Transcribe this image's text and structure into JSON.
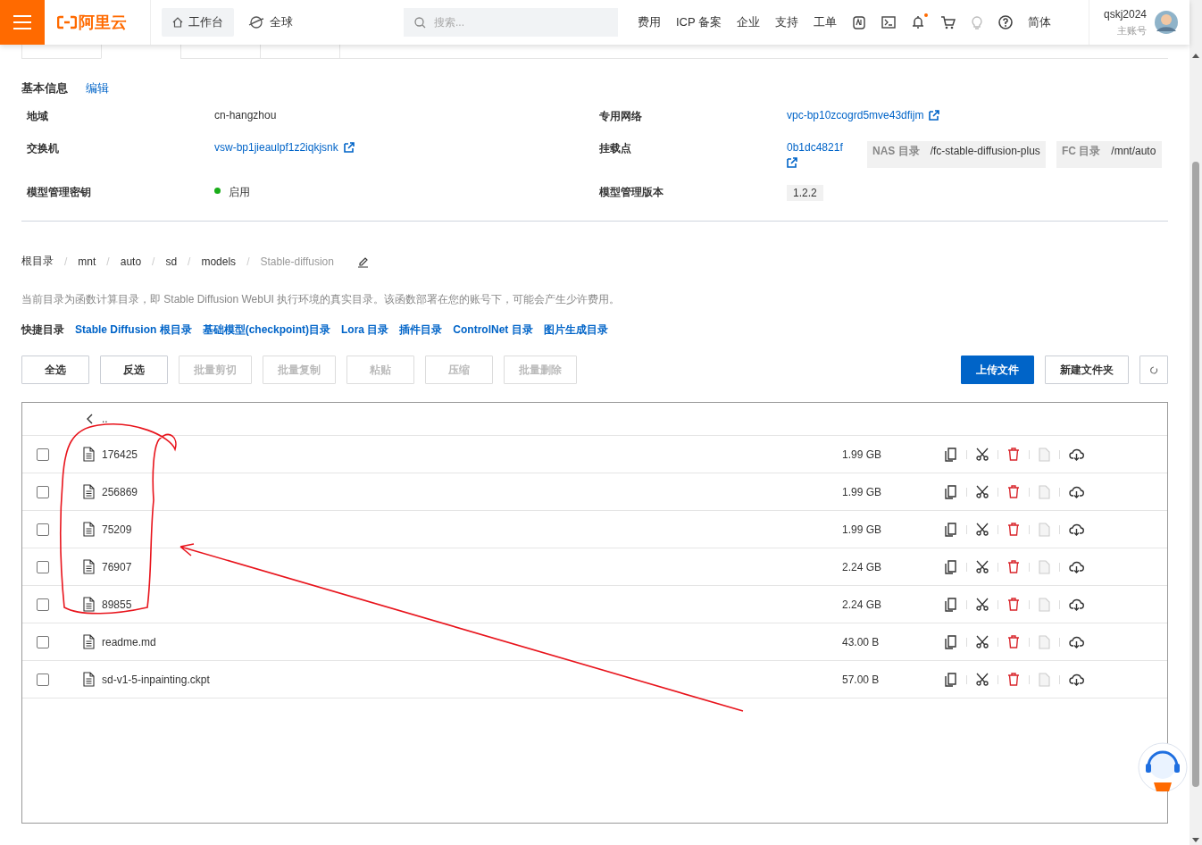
{
  "header": {
    "logo": "阿里云",
    "nav": [
      {
        "label": "工作台",
        "selected": true
      },
      {
        "label": "全球",
        "selected": false
      }
    ],
    "search": {
      "placeholder": "搜索..."
    },
    "links": [
      "费用",
      "ICP 备案",
      "企业",
      "支持",
      "工单"
    ],
    "notifications": {
      "unread": true
    },
    "language": "简体",
    "user": {
      "name": "qskj2024",
      "role": "主账号"
    }
  },
  "basic_info": {
    "title": "基本信息",
    "edit": "编辑",
    "fields": [
      {
        "kind": "text",
        "label": "地域",
        "value": "cn-hangzhou"
      },
      {
        "kind": "link",
        "label": "专用网络",
        "value": "vpc-bp10zcogrd5mve43dfijm"
      },
      {
        "kind": "link",
        "label": "交换机",
        "value": "vsw-bp1jieaulpf1z2iqkjsnk"
      },
      {
        "kind": "mount",
        "label": "挂载点",
        "value": "0b1dc4821f",
        "tags": [
          {
            "label": "NAS 目录",
            "value": "/fc-stable-diffusion-plus"
          },
          {
            "label": "FC 目录",
            "value": "/mnt/auto"
          }
        ]
      },
      {
        "kind": "status",
        "label": "模型管理密钥",
        "value": "启用",
        "on": true
      },
      {
        "kind": "tag",
        "label": "模型管理版本",
        "value": "1.2.2"
      }
    ]
  },
  "breadcrumb_separator": "/",
  "breadcrumb": [
    {
      "label": "根目录",
      "current": false
    },
    {
      "label": "mnt",
      "current": false
    },
    {
      "label": "auto",
      "current": false
    },
    {
      "label": "sd",
      "current": false
    },
    {
      "label": "models",
      "current": false
    },
    {
      "label": "Stable-diffusion",
      "current": true
    }
  ],
  "note": "当前目录为函数计算目录，即 Stable Diffusion WebUI 执行环境的真实目录。该函数部署在您的账号下，可能会产生少许费用。",
  "quick_dirs": {
    "label": "快捷目录",
    "links": [
      "Stable Diffusion 根目录",
      "基础模型(checkpoint)目录",
      "Lora 目录",
      "插件目录",
      "ControlNet 目录",
      "图片生成目录"
    ]
  },
  "toolbar": [
    {
      "label": "全选",
      "disabled": false
    },
    {
      "label": "反选",
      "disabled": false
    },
    {
      "label": "批量剪切",
      "disabled": true
    },
    {
      "label": "批量复制",
      "disabled": true
    },
    {
      "label": "粘贴",
      "disabled": true
    },
    {
      "label": "压缩",
      "disabled": true
    },
    {
      "label": "批量删除",
      "disabled": true
    }
  ],
  "actions": [
    {
      "label": "上传文件",
      "kind": "primary"
    },
    {
      "label": "新建文件夹",
      "kind": "default"
    }
  ],
  "files": {
    "parent": "..",
    "rows": [
      {
        "name": "176425",
        "size": "1.99 GB",
        "checked": false
      },
      {
        "name": "256869",
        "size": "1.99 GB",
        "checked": false
      },
      {
        "name": "75209",
        "size": "1.99 GB",
        "checked": false
      },
      {
        "name": "76907",
        "size": "2.24 GB",
        "checked": false
      },
      {
        "name": "89855",
        "size": "2.24 GB",
        "checked": false
      },
      {
        "name": "readme.md",
        "size": "43.00 B",
        "checked": false
      },
      {
        "name": "sd-v1-5-inpainting.ckpt",
        "size": "57.00 B",
        "checked": false
      }
    ]
  }
}
